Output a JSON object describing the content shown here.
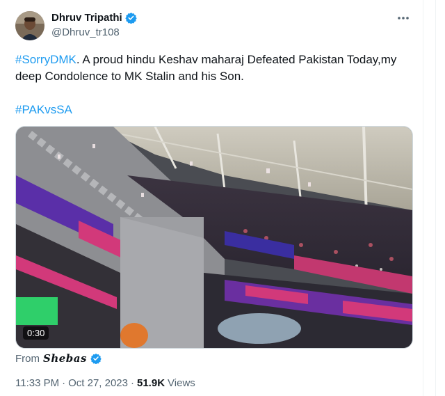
{
  "author": {
    "display_name": "Dhruv Tripathi",
    "handle": "@Dhruv_tr108",
    "verified_icon": "verified-badge-icon",
    "accent_color": "#1d9bf0"
  },
  "tweet": {
    "hashtag_1": "#SorryDMK",
    "body": ". A proud hindu Keshav maharaj Defeated Pakistan Today,my deep Condolence to MK Stalin and his Son.",
    "hashtag_2": "#PAKvsSA"
  },
  "video": {
    "duration": "0:30",
    "source_label": "From",
    "source_name": "Shebas"
  },
  "meta": {
    "time": "11:33 PM",
    "separator_1": "·",
    "date": "Oct 27, 2023",
    "separator_2": "·",
    "views_count": "51.9K",
    "views_label": "Views"
  }
}
